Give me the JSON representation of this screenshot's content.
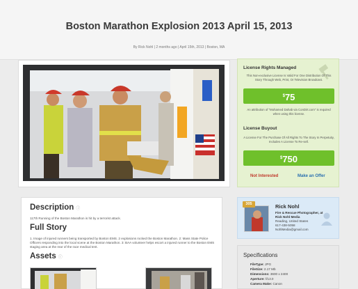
{
  "page": {
    "title": "Boston Marathon Explosion 2013 April 15, 2013",
    "meta": "By Rick Nohl | 2 months ago | April 15th, 2013 | Boston, MA"
  },
  "photo": {
    "alt": "Boston EMS responders transport injured runner on stretcher"
  },
  "description": {
    "heading": "Description",
    "text": "117th Running of the Boston Marathon is hit by a terrorist attack."
  },
  "story": {
    "heading": "Full Story",
    "text": "1. Image of injured runners being transported by Boston EMS. 2 explosions rocked the Boston Marathon. 2: Mass State Police Officers responding into the local scene at the Boston Marathon. 3: BAA volunteer helps escort a injured runner to the Boston EMS staging area at the rear of the race medical tent."
  },
  "assets": {
    "heading": "Assets"
  },
  "license": {
    "managed_heading": "License Rights Managed",
    "managed_text": "This Non-exclusive License Is Valid For One Distribution Of This Story Through Web, Print, Or Television Broadcast.",
    "managed_price_symbol": "$",
    "managed_price": "75",
    "attribution_text": "An attribution of \"Mohamed Dahab via ConDirt.com\" is required when using this license.",
    "buyout_heading": "License Buyout",
    "buyout_text": "A License For The Purchase Of All Rights To The Story In Perpetuity, Includes A License To Re-sell.",
    "buyout_price_symbol": "$",
    "buyout_price": "750",
    "not_interested": "Not Interested",
    "make_offer": "Make an Offer"
  },
  "profile": {
    "badge": "305",
    "name": "Rick Nohl",
    "title": "Fire & Rescue Photographer, at",
    "company": "Rick Nohl Media",
    "location": "Reading, United States",
    "phone": "617-438-5058",
    "email": "NohlMedia@gmail.com"
  },
  "specs": {
    "heading": "Specifications",
    "rows": [
      {
        "label": "FileType:",
        "value": "JPG"
      },
      {
        "label": "FileSize:",
        "value": "2.17 Mb"
      },
      {
        "label": "Dimensions:",
        "value": "3600 x 2400"
      },
      {
        "label": "Aperture:",
        "value": "f/13.0"
      },
      {
        "label": "Camera Make:",
        "value": "Canon"
      }
    ]
  },
  "colors": {
    "accent_green": "#6fc02b",
    "not_interested_red": "#c0392b",
    "offer_blue": "#2a6fb0",
    "rights_bg": "#e6f2d1",
    "profile_bg": "#dbeaf7"
  }
}
